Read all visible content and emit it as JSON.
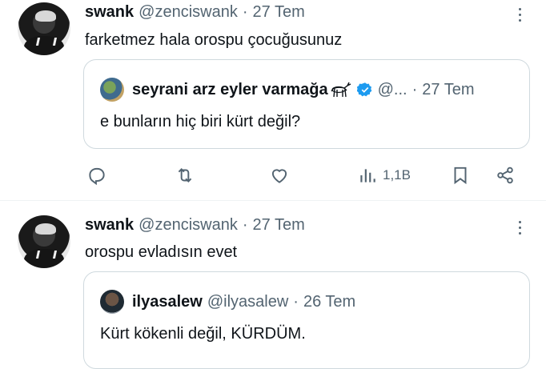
{
  "tweets": [
    {
      "author_name": "swank",
      "author_handle": "@zenciswank",
      "separator": "·",
      "date": "27 Tem",
      "text": "farketmez hala orospu çocuğusunuz",
      "quote": {
        "author_name": "seyrani arz eyler varmağa",
        "author_handle": "@...",
        "separator": "·",
        "date": "27 Tem",
        "verified": true,
        "text": "e bunların hiç biri kürt değil?"
      },
      "actions": {
        "views_count": "1,1B"
      }
    },
    {
      "author_name": "swank",
      "author_handle": "@zenciswank",
      "separator": "·",
      "date": "27 Tem",
      "text": "orospu evladısın evet",
      "quote": {
        "author_name": "ilyasalew",
        "author_handle": "@ilyasalew",
        "separator": "·",
        "date": "26 Tem",
        "text": "Kürt kökenli değil, KÜRDÜM."
      }
    }
  ],
  "colors": {
    "text_primary": "#0f1419",
    "text_secondary": "#536471",
    "border": "#cfd9de",
    "verified_blue": "#1d9bf0"
  }
}
